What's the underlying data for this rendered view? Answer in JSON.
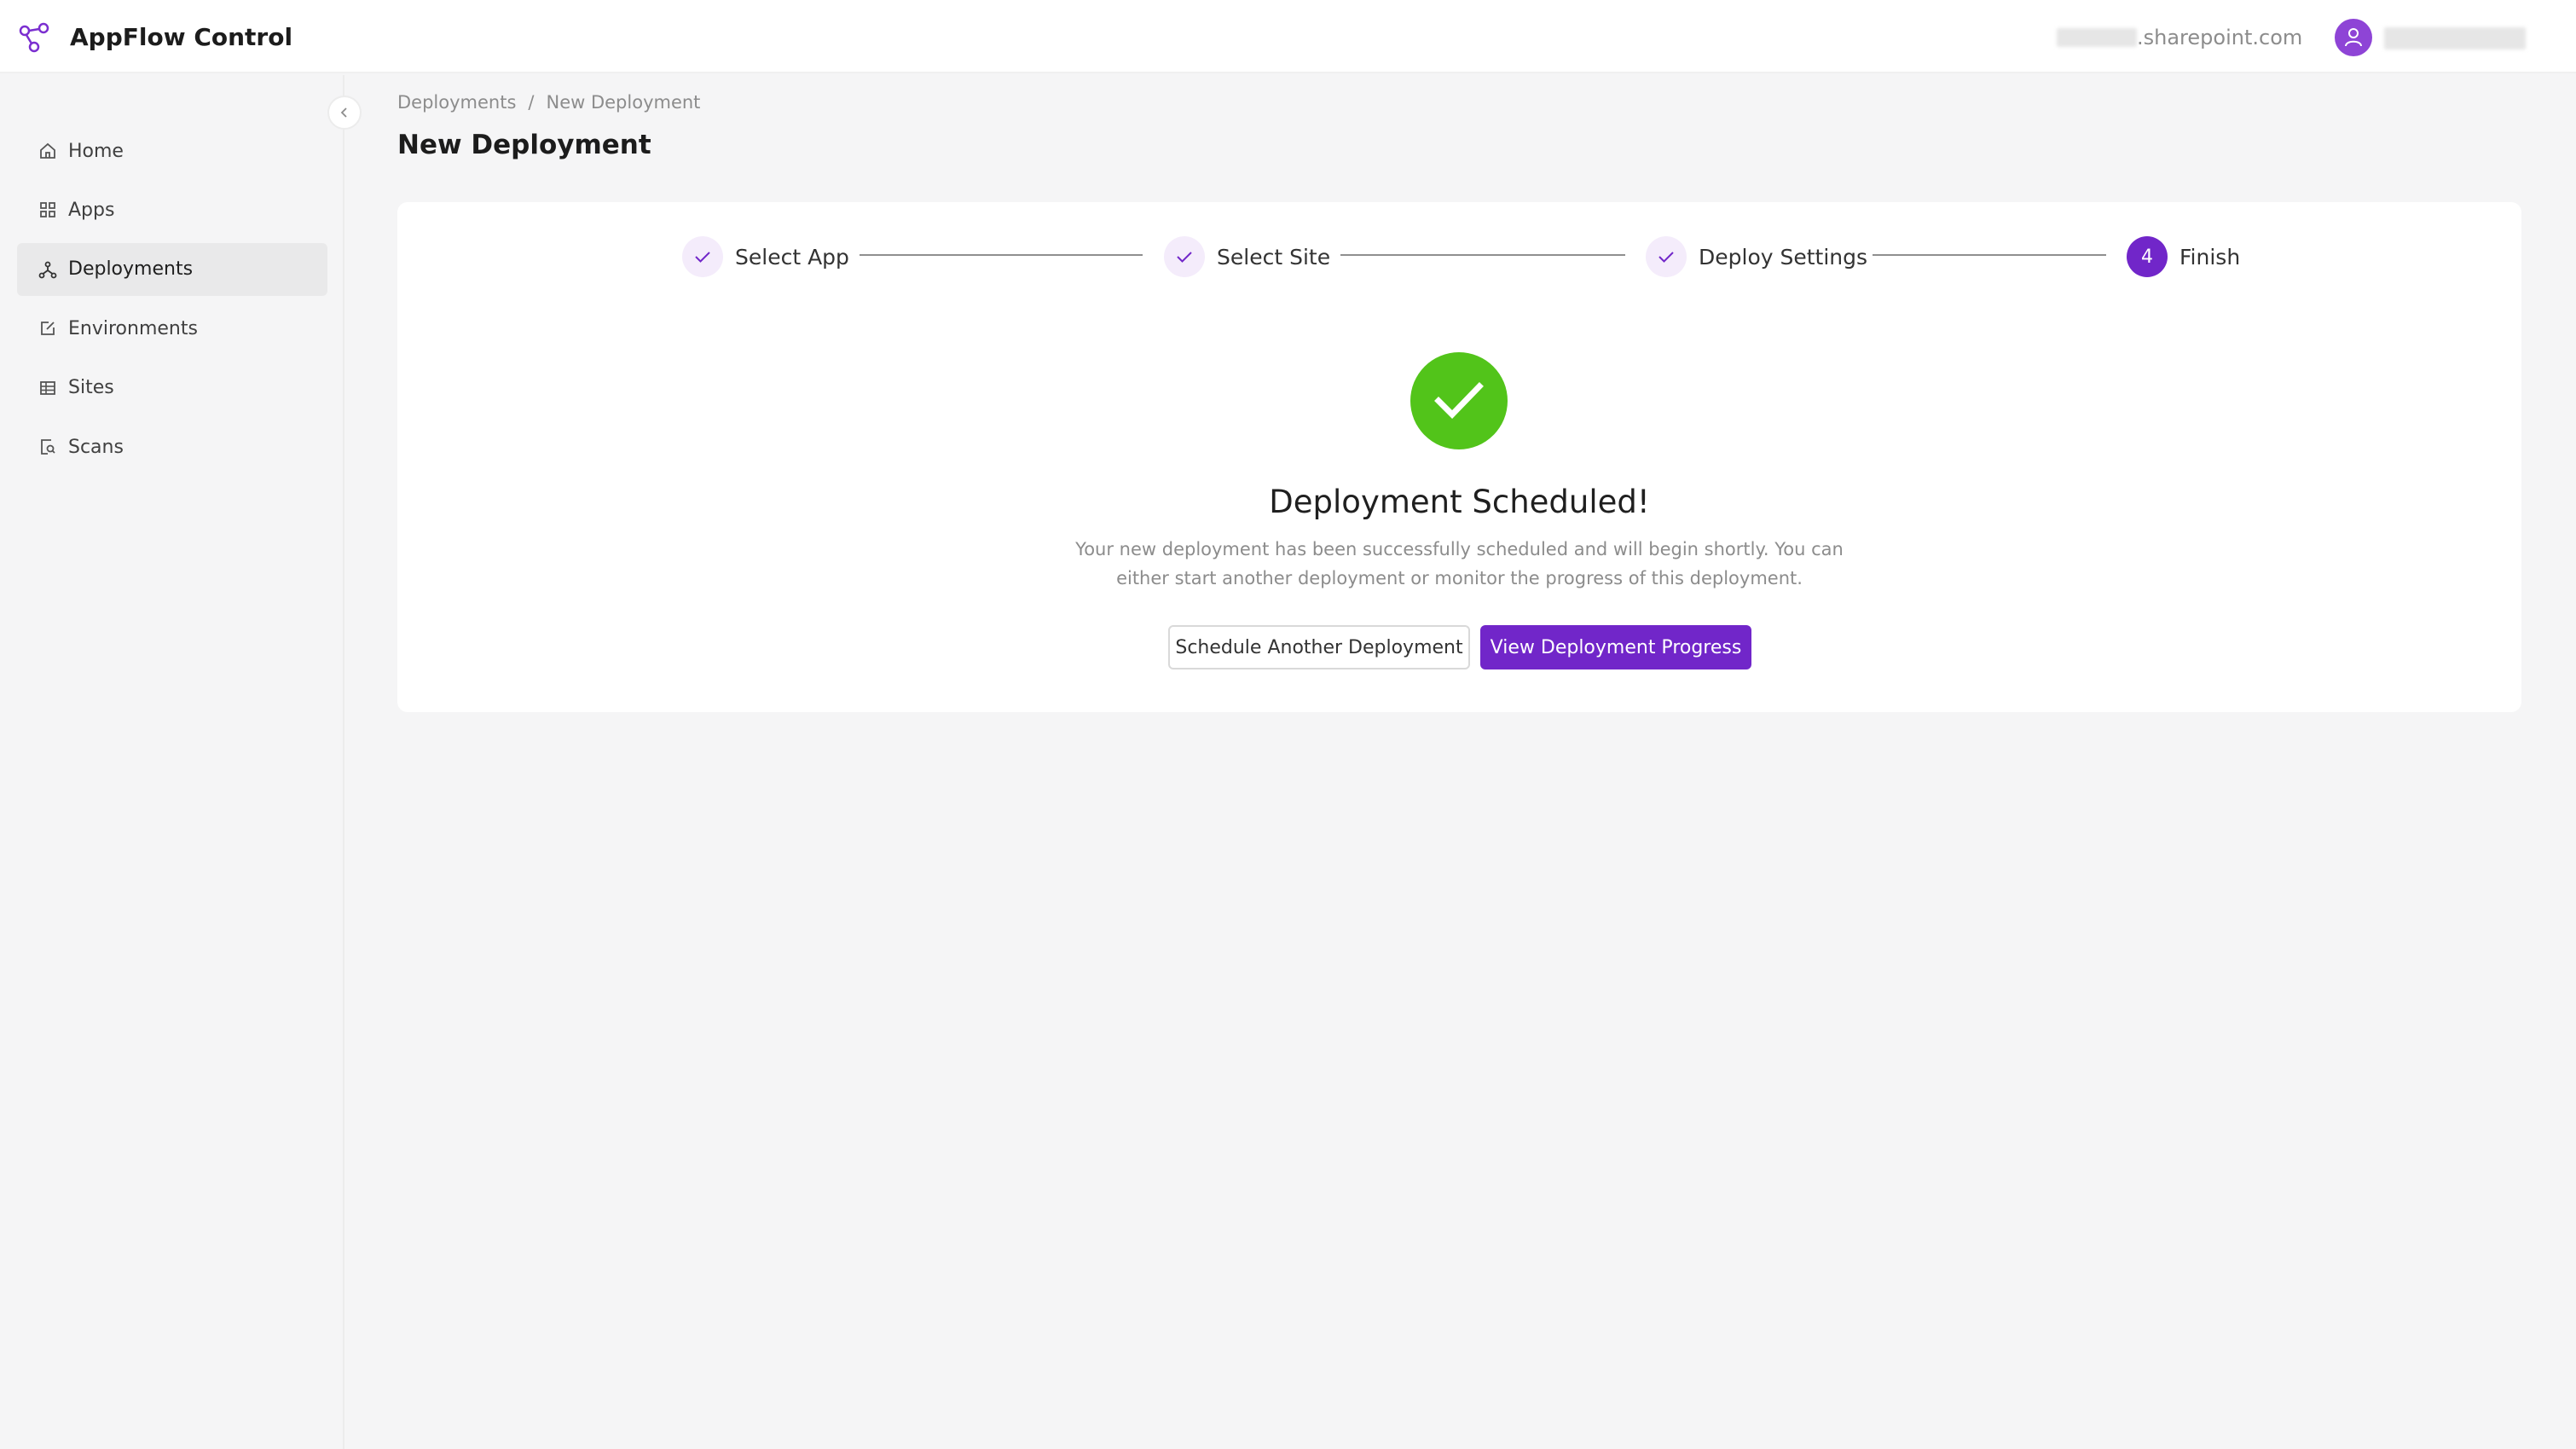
{
  "app": {
    "title": "AppFlow Control"
  },
  "header": {
    "tenant_domain": ".sharepoint.com"
  },
  "sidebar": {
    "items": [
      {
        "label": "Home",
        "icon": "home-icon"
      },
      {
        "label": "Apps",
        "icon": "apps-grid-icon"
      },
      {
        "label": "Deployments",
        "icon": "deployments-icon",
        "active": true
      },
      {
        "label": "Environments",
        "icon": "edit-icon"
      },
      {
        "label": "Sites",
        "icon": "table-icon"
      },
      {
        "label": "Scans",
        "icon": "scan-icon"
      }
    ]
  },
  "breadcrumb": {
    "parent": "Deployments",
    "separator": "/",
    "current": "New Deployment"
  },
  "page": {
    "title": "New Deployment"
  },
  "steps": [
    {
      "label": "Select App",
      "status": "done"
    },
    {
      "label": "Select Site",
      "status": "done"
    },
    {
      "label": "Deploy Settings",
      "status": "done"
    },
    {
      "label": "Finish",
      "status": "current",
      "number": "4"
    }
  ],
  "result": {
    "title": "Deployment Scheduled!",
    "subtitle": "Your new deployment has been successfully scheduled and will begin shortly. You can either start another deployment or monitor the progress of this deployment.",
    "secondary_button": "Schedule Another Deployment",
    "primary_button": "View Deployment Progress"
  },
  "colors": {
    "accent": "#7126c9",
    "success": "#52c41a"
  }
}
